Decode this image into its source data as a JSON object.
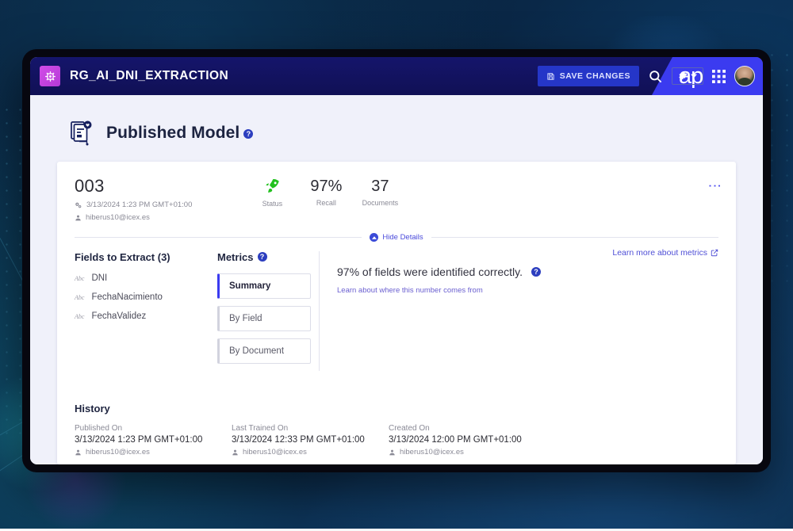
{
  "app": {
    "logo_icon": "chip-icon",
    "title": "RG_AI_DNI_EXTRACTION",
    "brand_mark": "ap"
  },
  "toolbar": {
    "save_label": "SAVE CHANGES",
    "save_icon": "floppy-save-icon",
    "search_icon": "search-icon",
    "settings_icon": "gear-icon",
    "settings_caret": "chevron-down-icon",
    "apps_icon": "grid-apps-icon",
    "avatar_icon": "user-avatar"
  },
  "page": {
    "title": "Published Model",
    "title_icon": "published-model-icon",
    "help_glyph": "?"
  },
  "model": {
    "id": "003",
    "timestamp": "3/13/2024 1:23 PM GMT+01:00",
    "timestamp_icon": "gears-icon",
    "user": "hiberus10@icex.es",
    "user_icon": "person-icon",
    "kebab_icon": "more-vertical-icon",
    "stats": [
      {
        "icon": "rocket-icon",
        "value": "",
        "label": "Status"
      },
      {
        "icon": "",
        "value": "97%",
        "label": "Recall"
      },
      {
        "icon": "",
        "value": "37",
        "label": "Documents"
      }
    ],
    "toggle_details_label": "Hide Details",
    "toggle_details_icon": "caret-up-circle-icon"
  },
  "fields": {
    "title": "Fields to Extract (3)",
    "items": [
      {
        "type_icon": "abc-text-icon",
        "type_label": "Abc",
        "name": "DNI"
      },
      {
        "type_icon": "abc-text-icon",
        "type_label": "Abc",
        "name": "FechaNacimiento"
      },
      {
        "type_icon": "abc-text-icon",
        "type_label": "Abc",
        "name": "FechaValidez"
      }
    ]
  },
  "metrics": {
    "title": "Metrics",
    "help_glyph": "?",
    "tabs": [
      {
        "label": "Summary",
        "active": true
      },
      {
        "label": "By Field",
        "active": false
      },
      {
        "label": "By Document",
        "active": false
      }
    ],
    "learn_more_label": "Learn more about metrics",
    "learn_more_icon": "external-link-icon",
    "headline": "97% of fields were identified correctly.",
    "headline_help_glyph": "?",
    "sub_link": "Learn about where this number comes from"
  },
  "history": {
    "title": "History",
    "entries": [
      {
        "label": "Published On",
        "value": "3/13/2024 1:23 PM GMT+01:00",
        "user": "hiberus10@icex.es",
        "user_icon": "person-icon"
      },
      {
        "label": "Last Trained On",
        "value": "3/13/2024 12:33 PM GMT+01:00",
        "user": "hiberus10@icex.es",
        "user_icon": "person-icon"
      },
      {
        "label": "Created On",
        "value": "3/13/2024 12:00 PM GMT+01:00",
        "user": "hiberus10@icex.es",
        "user_icon": "person-icon"
      }
    ]
  },
  "colors": {
    "topbar": "#141466",
    "accent_blue": "#3b3bf0",
    "logo_purple": "#c746e0",
    "status_green": "#22c11e",
    "page_bg": "#f0f1fa",
    "link": "#4f4fd6"
  }
}
